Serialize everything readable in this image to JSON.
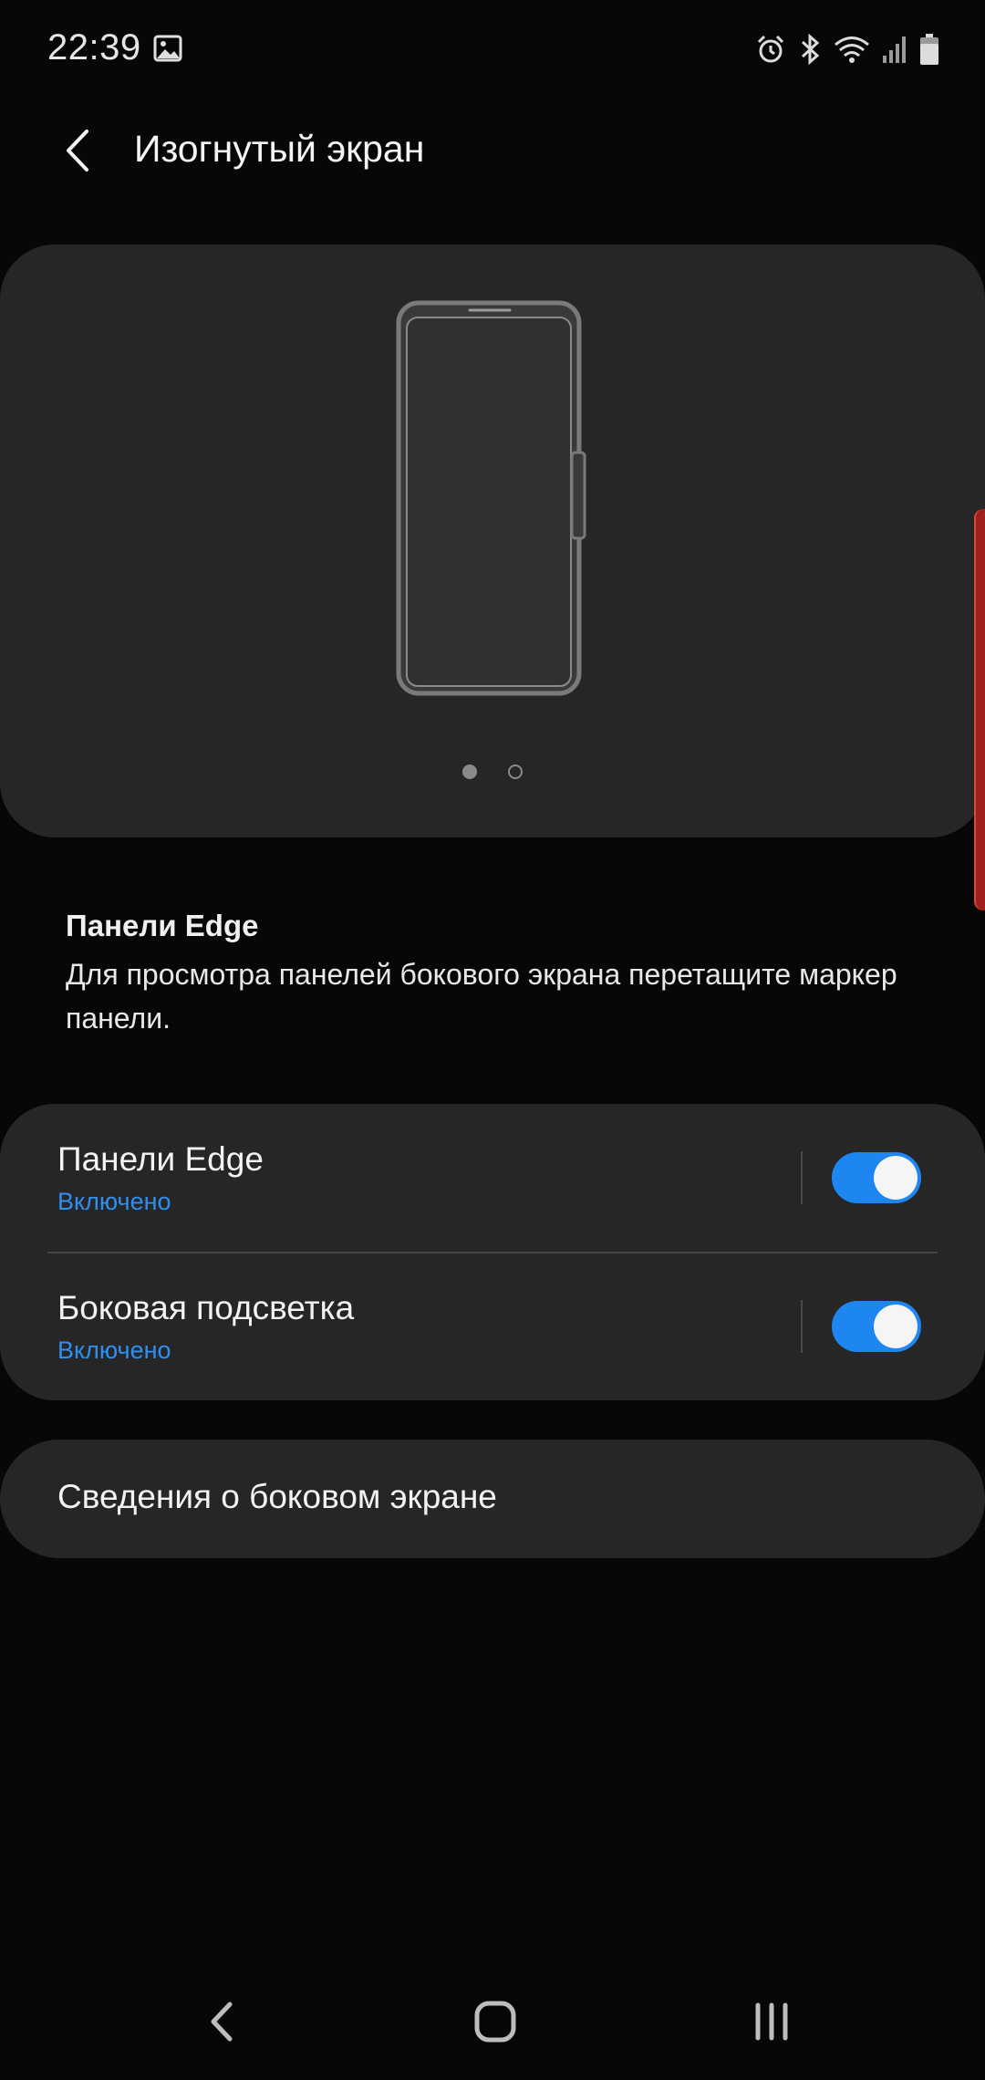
{
  "status_bar": {
    "time": "22:39",
    "left_icons": [
      "gallery-icon"
    ],
    "right_icons": [
      "alarm-icon",
      "bluetooth-icon",
      "wifi-icon",
      "signal-icon",
      "battery-icon"
    ]
  },
  "header": {
    "title": "Изогнутый экран",
    "back_icon": "chevron-left-icon"
  },
  "preview": {
    "illustration": "phone-with-edge-handle",
    "pager": {
      "total": 2,
      "active_index": 0
    }
  },
  "description": {
    "title": "Панели Edge",
    "text": "Для просмотра панелей бокового экрана перетащите маркер панели."
  },
  "settings": [
    {
      "title": "Панели Edge",
      "status": "Включено",
      "enabled": true
    },
    {
      "title": "Боковая подсветка",
      "status": "Включено",
      "enabled": true
    }
  ],
  "about": {
    "label": "Сведения о боковом экране"
  },
  "nav_bar": {
    "buttons": [
      "back-icon",
      "home-icon",
      "recent-apps-icon"
    ]
  },
  "colors": {
    "background": "#070707",
    "card": "#262626",
    "accent": "#1e86f0",
    "status_text": "#2f8ff0",
    "edge_handle": "#a0201e"
  }
}
